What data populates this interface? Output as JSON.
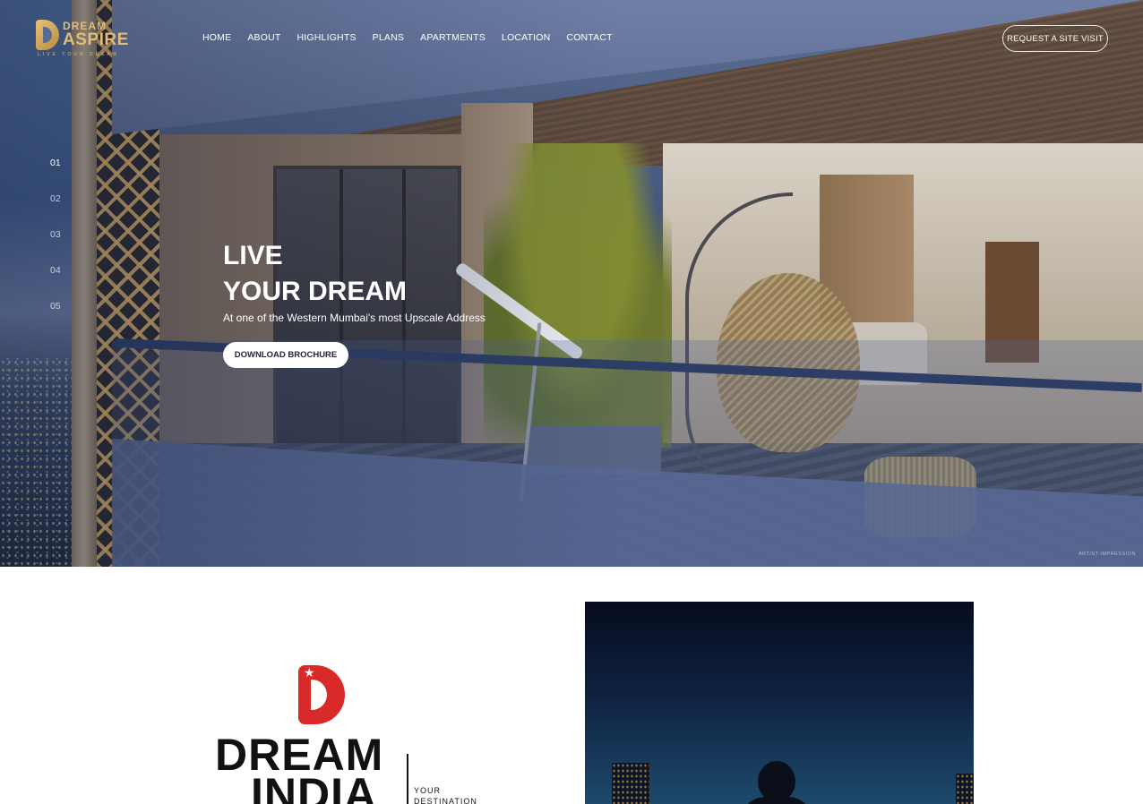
{
  "header": {
    "logo": {
      "line1": "DREAM",
      "line2": "ASPIRE",
      "tagline": "LIVE YOUR DREAM"
    },
    "nav": [
      "HOME",
      "ABOUT",
      "HIGHLIGHTS",
      "PLANS",
      "APARTMENTS",
      "LOCATION",
      "CONTACT"
    ],
    "cta": "REQUEST A SITE VISIT"
  },
  "hero": {
    "slides": [
      "01",
      "02",
      "03",
      "04",
      "05"
    ],
    "active_slide": "01",
    "title_line1": "LIVE",
    "title_line2": "YOUR DREAM",
    "subtitle": "At one of the Western Mumbai's most Upscale Address",
    "brochure_button": "DOWNLOAD BROCHURE",
    "impression_note": "ARTIST IMPRESSION"
  },
  "developer": {
    "name_line1": "DREAM",
    "name_line2": "INDIA",
    "tagline_line1": "YOUR",
    "tagline_line2": "DESTINATION"
  },
  "colors": {
    "gold": "#e3bd72",
    "red": "#d92a2a",
    "text_dark": "#111111",
    "hero_blue": "#5b6e93"
  }
}
